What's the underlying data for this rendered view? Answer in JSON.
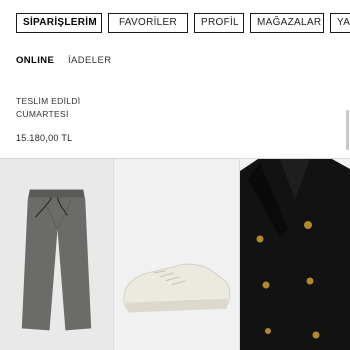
{
  "nav": {
    "tabs": [
      {
        "label": "SİPARİŞLERİM",
        "active": true
      },
      {
        "label": "FAVORİLER",
        "active": false
      },
      {
        "label": "PROFİL",
        "active": false
      },
      {
        "label": "MAĞAZALAR",
        "active": false
      },
      {
        "label": "YARDIM",
        "active": false
      }
    ]
  },
  "subtabs": [
    {
      "label": "ONLINE",
      "active": true
    },
    {
      "label": "İADELER",
      "active": false
    }
  ],
  "order": {
    "status": "TESLİM EDİLDİ",
    "day": "CUMARTESİ",
    "price": "15.180,00 TL"
  },
  "products": [
    {
      "item": "pants-image",
      "color": "#6b6b67"
    },
    {
      "item": "sneaker-image",
      "color": "#ece9e1"
    },
    {
      "item": "coat-image",
      "color": "#121212",
      "accent": "#b08a2a"
    }
  ]
}
